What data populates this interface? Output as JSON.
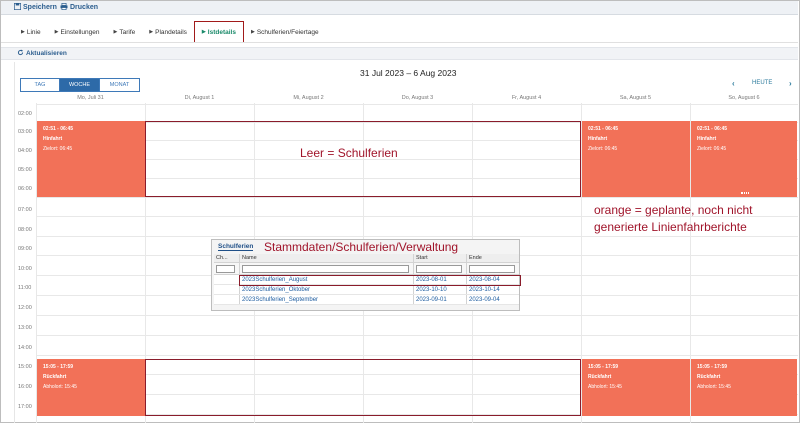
{
  "toolbar": {
    "save_label": "Speichern",
    "print_label": "Drucken"
  },
  "tabs": [
    {
      "label": "Linie"
    },
    {
      "label": "Einstellungen"
    },
    {
      "label": "Tarife"
    },
    {
      "label": "Plandetails"
    },
    {
      "label": "Istdetails"
    },
    {
      "label": "Schulferien/Feiertage"
    }
  ],
  "refresh_label": "Aktualisieren",
  "calendar": {
    "range_title": "31 Jul 2023 – 6 Aug 2023",
    "views": [
      "TAG",
      "WOCHE",
      "MONAT"
    ],
    "active_view": "WOCHE",
    "today_label": "HEUTE",
    "prev_symbol": "‹",
    "next_symbol": "›",
    "days": [
      "Mo, Juli 31",
      "Di, August 1",
      "Mi, August 2",
      "Do, August 3",
      "Fr, August 4",
      "Sa, August 5",
      "So, August 6"
    ],
    "hours": [
      "02:00",
      "03:00",
      "04:00",
      "05:00",
      "06:00",
      "07:00",
      "08:00",
      "09:00",
      "10:00",
      "11:00",
      "12:00",
      "13:00",
      "14:00",
      "15:00",
      "16:00",
      "17:00"
    ],
    "events": {
      "morning": {
        "time": "02:51 - 06:45",
        "title": "Hinfahrt",
        "detail": "Zielort: 06:45"
      },
      "afternoon": {
        "time": "15:05 - 17:59",
        "title": "Rückfahrt",
        "detail": "Abholort: 15:45"
      }
    }
  },
  "annotations": {
    "empty": "Leer = Schulferien",
    "orange_line1": "orange = geplante, noch nicht",
    "orange_line2": "generierte Linienfahrberichte",
    "path": "Stammdaten/Schulferien/Verwaltung"
  },
  "popup": {
    "title": "Schulferien",
    "columns": [
      "Ch...",
      "Name",
      "Start",
      "Ende"
    ],
    "rows": [
      {
        "name": "2023Schulferien_August",
        "start": "2023-08-01",
        "end": "2023-08-04"
      },
      {
        "name": "2023Schulferien_Oktober",
        "start": "2023-10-10",
        "end": "2023-10-14"
      },
      {
        "name": "2023Schulferien_September",
        "start": "2023-09-01",
        "end": "2023-09-04"
      }
    ]
  },
  "colors": {
    "event": "#f27158",
    "highlight": "#8a1c2b",
    "accent": "#2d6aa8"
  }
}
